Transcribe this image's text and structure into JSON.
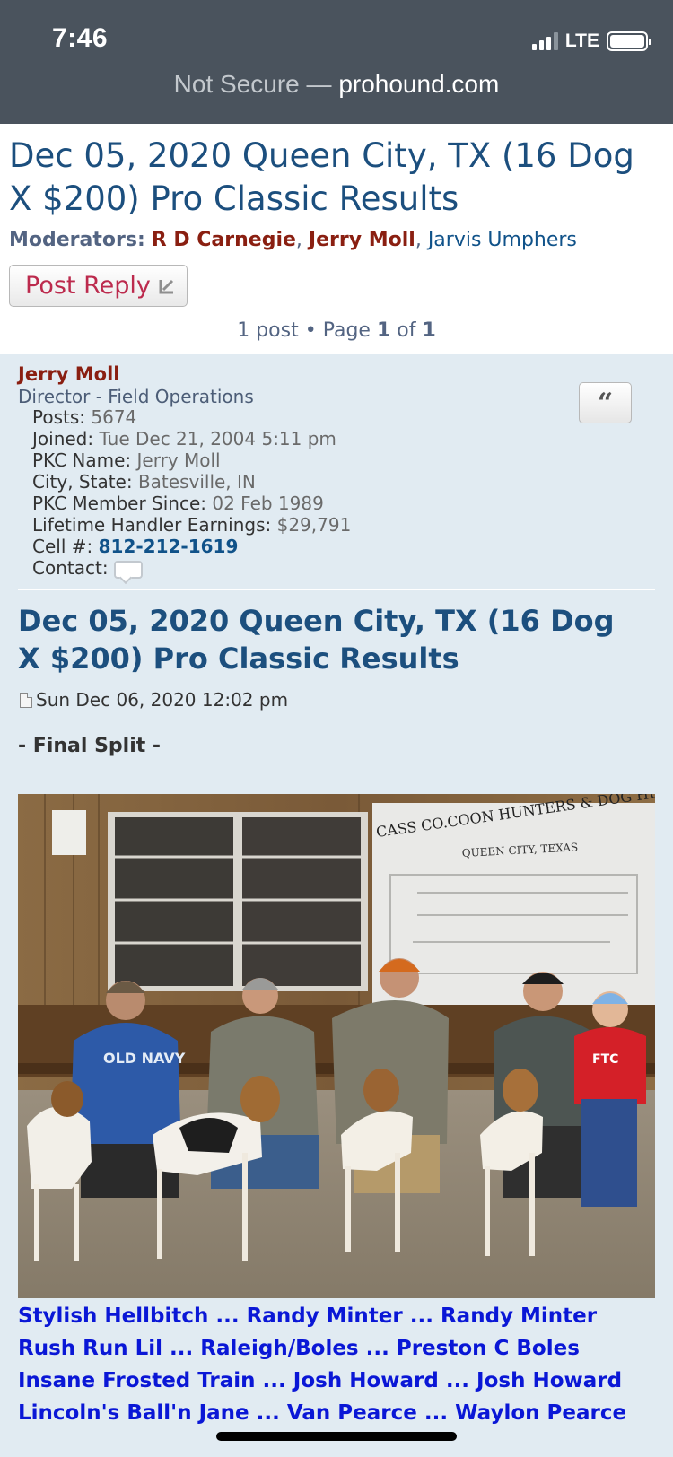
{
  "status_bar": {
    "time": "7:46",
    "network": "LTE",
    "icons": [
      "signal-icon",
      "battery-icon"
    ]
  },
  "browser": {
    "security": "Not Secure",
    "separator": "—",
    "domain": "prohound.com"
  },
  "topic": {
    "title": "Dec 05, 2020 Queen City, TX (16 Dog X $200) Pro Classic Results",
    "moderators_label": "Moderators:",
    "moderators": [
      "R D Carnegie",
      "Jerry Moll",
      "Jarvis Umphers"
    ],
    "post_reply_label": "Post Reply",
    "pagination": {
      "count_text": "1 post",
      "bullet": "•",
      "page_label": "Page",
      "current": "1",
      "of_label": "of",
      "total": "1"
    }
  },
  "post": {
    "author": "Jerry Moll",
    "rank": "Director - Field Operations",
    "quote_label": "“",
    "profile": [
      {
        "label": "Posts:",
        "value": "5674"
      },
      {
        "label": "Joined:",
        "value": "Tue Dec 21, 2004 5:11 pm"
      },
      {
        "label": "PKC Name:",
        "value": "Jerry Moll"
      },
      {
        "label": "City, State:",
        "value": "Batesville, IN"
      },
      {
        "label": "PKC Member Since:",
        "value": "02 Feb 1989"
      },
      {
        "label": "Lifetime Handler Earnings:",
        "value": "$29,791"
      },
      {
        "label": "Cell #:",
        "value": "812-212-1619"
      },
      {
        "label": "Contact:",
        "value": ""
      }
    ],
    "title": "Dec 05, 2020 Queen City, TX (16 Dog X $200) Pro Classic Results",
    "date": "Sun Dec 06, 2020 12:02 pm",
    "heading": "- Final Split -",
    "photo": {
      "banner_line1": "CASS CO.COON HUNTERS & DOG HUNTERS ASSOC.",
      "banner_line2": "QUEEN CITY, TEXAS",
      "shirt_text": "OLD NAVY",
      "kid_shirt_text": "FTC"
    },
    "results": [
      "Stylish Hellbitch ... Randy Minter ... Randy Minter",
      "Rush Run Lil ... Raleigh/Boles ... Preston C Boles",
      "Insane Frosted Train ... Josh Howard ... Josh Howard",
      "Lincoln's Ball'n Jane ... Van Pearce ... Waylon Pearce"
    ]
  }
}
